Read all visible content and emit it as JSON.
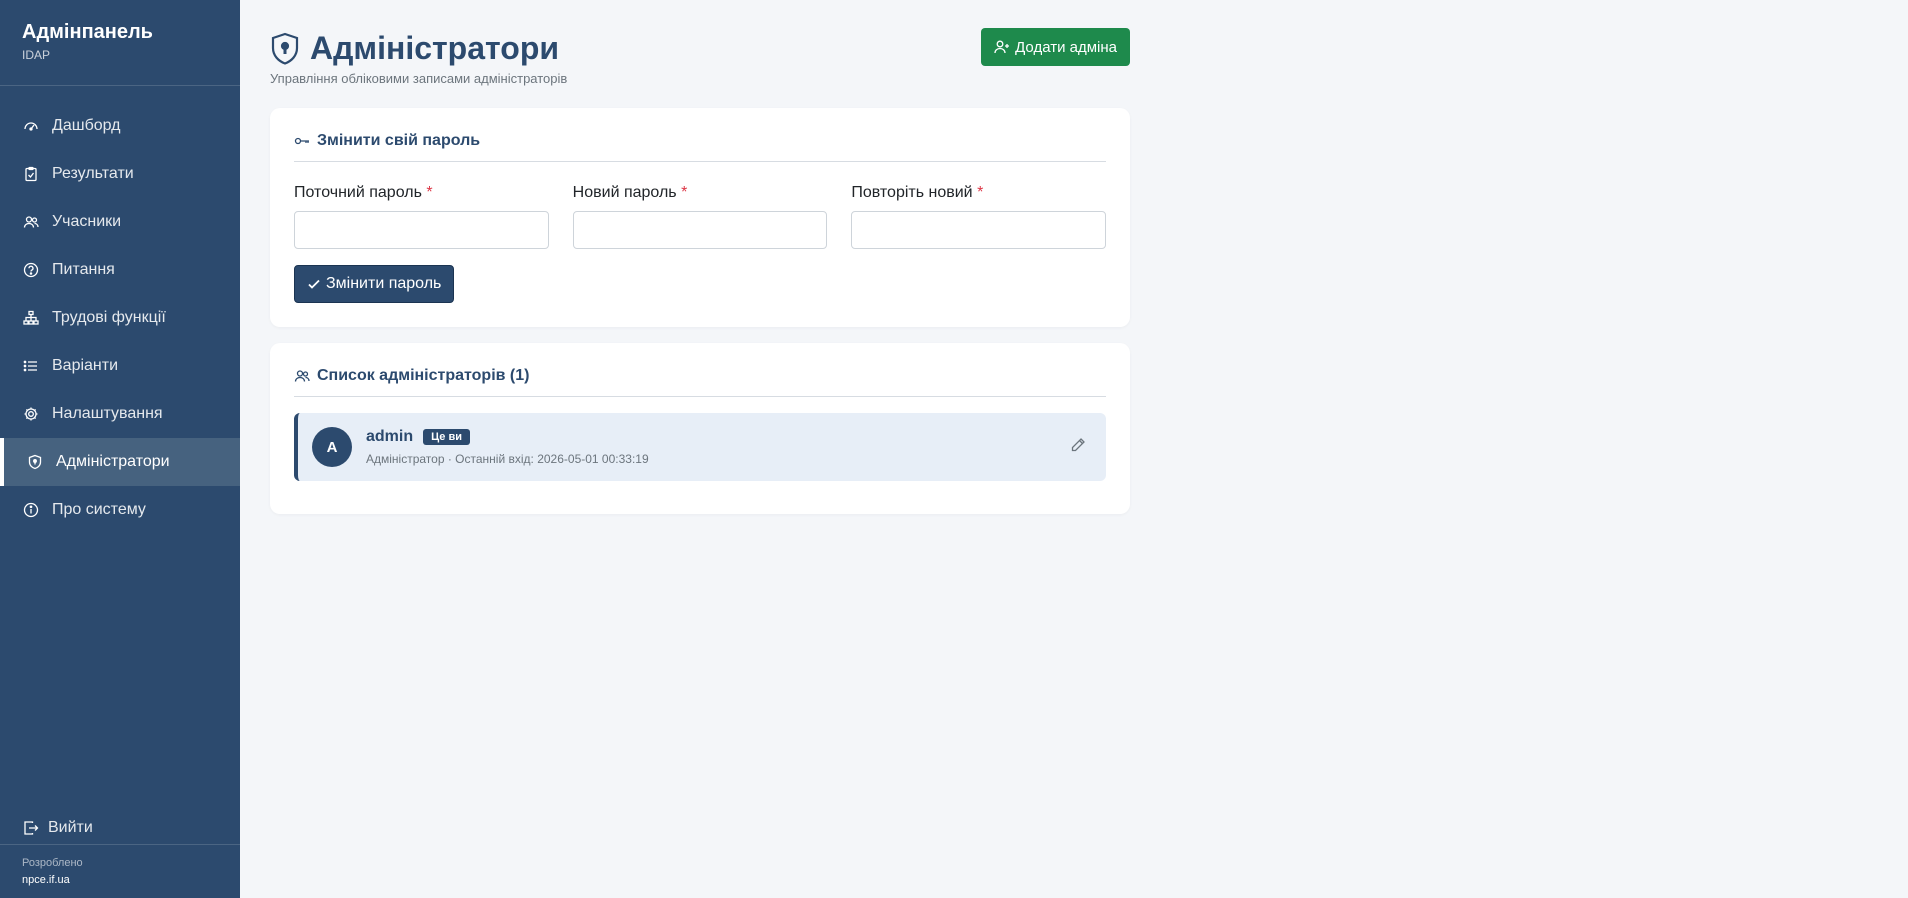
{
  "sidebar": {
    "brand_title": "Адмінпанель",
    "brand_sub": "IDAP",
    "items": [
      {
        "label": "Дашборд",
        "icon": "gauge-icon"
      },
      {
        "label": "Результати",
        "icon": "clipboard-check-icon"
      },
      {
        "label": "Учасники",
        "icon": "people-icon"
      },
      {
        "label": "Питання",
        "icon": "question-circle-icon"
      },
      {
        "label": "Трудові функції",
        "icon": "diagram-icon"
      },
      {
        "label": "Варіанти",
        "icon": "list-icon"
      },
      {
        "label": "Налаштування",
        "icon": "gear-icon"
      },
      {
        "label": "Адміністратори",
        "icon": "shield-lock-icon",
        "active": true
      },
      {
        "label": "Про систему",
        "icon": "info-circle-icon"
      }
    ],
    "logout_label": "Вийти",
    "footer_label": "Розроблено",
    "footer_link": "npce.if.ua"
  },
  "header": {
    "title": "Адміністратори",
    "subtitle": "Управління обліковими записами адміністраторів",
    "add_button_label": "Додати адміна"
  },
  "password_card": {
    "title": "Змінити свій пароль",
    "fields": [
      {
        "label": "Поточний пароль",
        "required_mark": "*",
        "value": ""
      },
      {
        "label": "Новий пароль",
        "required_mark": "*",
        "value": ""
      },
      {
        "label": "Повторіть новий",
        "required_mark": "*",
        "value": ""
      }
    ],
    "submit_label": "Змінити пароль"
  },
  "admins_card": {
    "title": "Список адміністраторів (1)",
    "admins": [
      {
        "initial": "A",
        "name": "admin",
        "badge": "Це ви",
        "meta": "Адміністратор · Останній вхід: 2026-05-01 00:33:19"
      }
    ]
  },
  "colors": {
    "sidebar_bg": "#2c4a6e",
    "primary": "#2c4a6e",
    "success": "#1e8a4c",
    "required": "#dc3545"
  }
}
